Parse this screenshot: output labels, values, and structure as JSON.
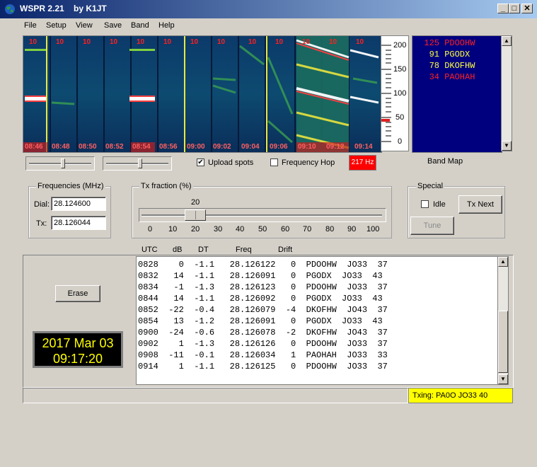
{
  "window": {
    "title": "WSPR 2.21    by K1JT",
    "minimize": "_",
    "maximize": "□",
    "close": "✕"
  },
  "menu": [
    "File",
    "Setup",
    "View",
    "Save",
    "Band",
    "Help"
  ],
  "waterfall": {
    "top_labels": [
      "10",
      "10",
      "10",
      "10",
      "10",
      "10",
      "10",
      "10",
      "10",
      "10",
      "10",
      "10",
      "10"
    ],
    "time_labels": [
      "08:46",
      "08:48",
      "08:50",
      "08:52",
      "08:54",
      "08:56",
      "09:00",
      "09:02",
      "09:04",
      "09:06",
      "09:10",
      "09:12",
      "09:14"
    ],
    "scale_ticks": [
      "200",
      "150",
      "100",
      "50",
      "0"
    ]
  },
  "bandmap": {
    "title": "Band Map",
    "entries": [
      {
        "freq": "125",
        "call": "PDOOHW",
        "color": "#ff2020"
      },
      {
        "freq": "91",
        "call": "PGODX",
        "color": "#ffff40"
      },
      {
        "freq": "78",
        "call": "DKOFHW",
        "color": "#ffff40"
      },
      {
        "freq": "34",
        "call": "PAOHAH",
        "color": "#ff2020"
      }
    ]
  },
  "controls": {
    "upload_spots_label": "Upload spots",
    "upload_spots_checked": true,
    "frequency_hop_label": "Frequency Hop",
    "frequency_hop_checked": false,
    "hz_badge": "217 Hz",
    "hz_badge_color": "#ff0000"
  },
  "frequencies": {
    "title": "Frequencies (MHz)",
    "dial_label": "Dial:",
    "dial_value": "28.124600",
    "tx_label": "Tx:",
    "tx_value": "28.126044"
  },
  "tx_fraction": {
    "title": "Tx fraction (%)",
    "value_label": "20",
    "value": 20,
    "ticks": [
      "0",
      "10",
      "20",
      "30",
      "40",
      "50",
      "60",
      "70",
      "80",
      "90",
      "100"
    ]
  },
  "special": {
    "title": "Special",
    "idle_label": "Idle",
    "idle_checked": false,
    "tx_next_label": "Tx Next",
    "tune_label": "Tune"
  },
  "decodes": {
    "headers": {
      "utc": "UTC",
      "db": "dB",
      "dt": "DT",
      "freq": "Freq",
      "drift": "Drift"
    },
    "rows": [
      "0828    0  -1.1   28.126122   0  PDOOHW  JO33  37",
      "0832   14  -1.1   28.126091   0  PGODX  JO33  43",
      "0834   -1  -1.3   28.126123   0  PDOOHW  JO33  37",
      "0844   14  -1.1   28.126092   0  PGODX  JO33  43",
      "0852  -22  -0.4   28.126079  -4  DKOFHW  JO43  37",
      "0854   13  -1.2   28.126091   0  PGODX  JO33  43",
      "0900  -24  -0.6   28.126078  -2  DKOFHW  JO43  37",
      "0902    1  -1.3   28.126126   0  PDOOHW  JO33  37",
      "0908  -11  -0.1   28.126034   1  PAOHAH  JO33  33",
      "0914    1  -1.1   28.126125   0  PDOOHW  JO33  37"
    ]
  },
  "erase_label": "Erase",
  "clock": {
    "date": "2017 Mar 03",
    "time": "09:17:20"
  },
  "status": {
    "txing": "Txing: PA0O JO33 40",
    "txing_color": "#ffff00"
  }
}
